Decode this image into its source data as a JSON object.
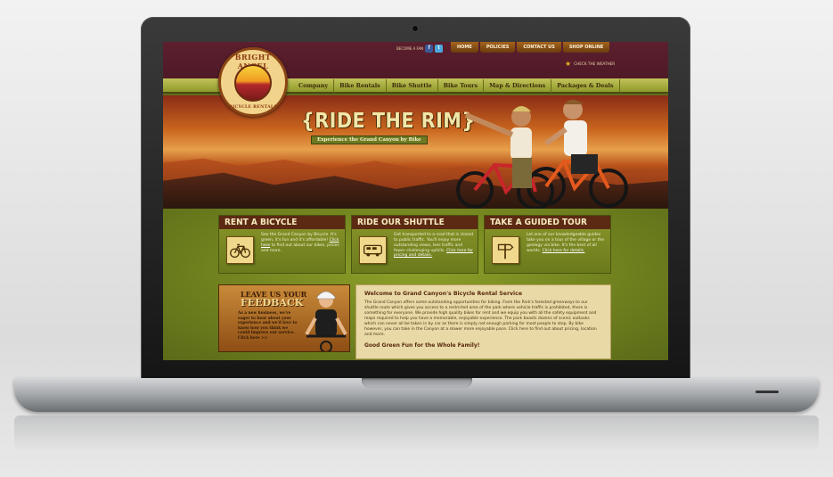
{
  "site": {
    "logo": {
      "top": "BRIGHT ANGEL",
      "bottom": "BICYCLE RENTALS"
    },
    "fan_text": "BECOME A FAN",
    "top_links": [
      "HOME",
      "POLICIES",
      "CONTACT US",
      "SHOP ONLINE"
    ],
    "weather": "CHECK THE WEATHER",
    "nav": [
      "Company",
      "Bike Rentals",
      "Bike Shuttle",
      "Bike Tours",
      "Map & Directions",
      "Packages & Deals"
    ],
    "hero": {
      "title": "{RIDE THE RIM}",
      "subtitle": "Experience the Grand Canyon by Bike"
    },
    "cards": [
      {
        "title": "RENT A BICYCLE",
        "icon": "bicycle-icon",
        "text": "See the Grand Canyon by Bicycle. It's green, it's fun and it's affordable! ",
        "link": "Click here",
        "text_after": " to find out about our bikes, prices and more."
      },
      {
        "title": "RIDE OUR SHUTTLE",
        "icon": "shuttle-icon",
        "text": "Get transported to a road that is closed to public traffic. You'll enjoy more outstanding views, less traffic and fewer challenging uphills. ",
        "link": "Click here for pricing and details.",
        "text_after": ""
      },
      {
        "title": "TAKE A GUIDED TOUR",
        "icon": "signpost-icon",
        "text": "Let one of our knowledgeable guides take you on a tour of the village or the geology via bike. It's the best of all worlds. ",
        "link": "Click here for details.",
        "text_after": ""
      }
    ],
    "feedback": {
      "title_line1": "LEAVE US YOUR",
      "title_line2": "FEEDBACK",
      "text": "As a new business, we're eager to hear about your experience and we'd love to know how you think we could improve our service. Click here >>"
    },
    "welcome": {
      "title": "Welcome to Grand Canyon's Bicycle Rental Service",
      "body": "The Grand Canyon offers some outstanding opportunities for biking. From the Park's forested greenways to our shuttle route which gives you access to a restricted area of the park where vehicle traffic is prohibited, there is something for everyone. We provide high quality bikes for rent and we equip you with all the safety equipment and maps required to help you have a memorable, enjoyable experience. The park boasts dozens of scenic outlooks which can never all be taken in by car as there is simply not enough parking for most people to stop. By bike however, you can take in the Canyon at a slower more enjoyable pace. Click here to find out about pricing, location and more.",
      "subheading": "Good Green Fun for the Whole Family!"
    },
    "colors": {
      "maroon": "#5c1f2e",
      "olive": "#8da028",
      "cream": "#e8d9a6",
      "gold": "#e8b020"
    }
  }
}
